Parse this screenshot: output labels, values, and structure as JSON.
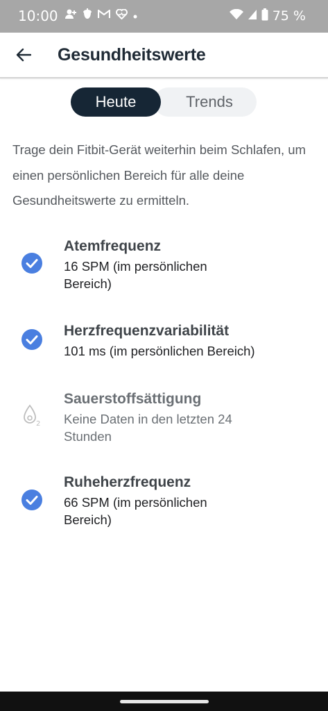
{
  "status_bar": {
    "time": "10:00",
    "battery": "75 %",
    "notification_icons": [
      "person-add-icon",
      "acorn-icon",
      "gmail-icon",
      "heart-pulse-icon",
      "dot-icon"
    ],
    "system_icons": [
      "wifi-icon",
      "signal-icon",
      "battery-icon"
    ]
  },
  "app_bar": {
    "back_icon": "arrow-back-icon",
    "title": "Gesundheitswerte"
  },
  "tabs": [
    {
      "label": "Heute",
      "active": true
    },
    {
      "label": "Trends",
      "active": false
    }
  ],
  "intro_text": "Trage dein Fitbit-Gerät weiterhin beim Schlafen, um einen persönlichen Bereich für alle deine Gesundheitswerte zu ermitteln.",
  "metrics": [
    {
      "title": "Atemfrequenz",
      "value": "16 SPM (im persönlichen Bereich)",
      "icon": "check-circle-icon"
    },
    {
      "title": "Herzfrequenzvariabilität",
      "value": "101 ms (im persönlichen Bereich)",
      "icon": "check-circle-icon"
    },
    {
      "title": "Sauerstoffsättigung",
      "value": "Keine Daten in den letzten 24 Stunden",
      "icon": "oxygen-drop-icon",
      "icon_label": "2"
    },
    {
      "title": "Ruheherzfrequenz",
      "value": "66 SPM (im persönlichen Bereich)",
      "icon": "check-circle-icon"
    }
  ],
  "colors": {
    "status_bar_bg": "#a7a7a7",
    "accent_blue": "#4a7fe0",
    "active_tab_bg": "#162635",
    "inactive_tab_bg": "#f0f2f4",
    "title_text": "#1f2a35",
    "muted_icon": "#bdbdbd"
  }
}
